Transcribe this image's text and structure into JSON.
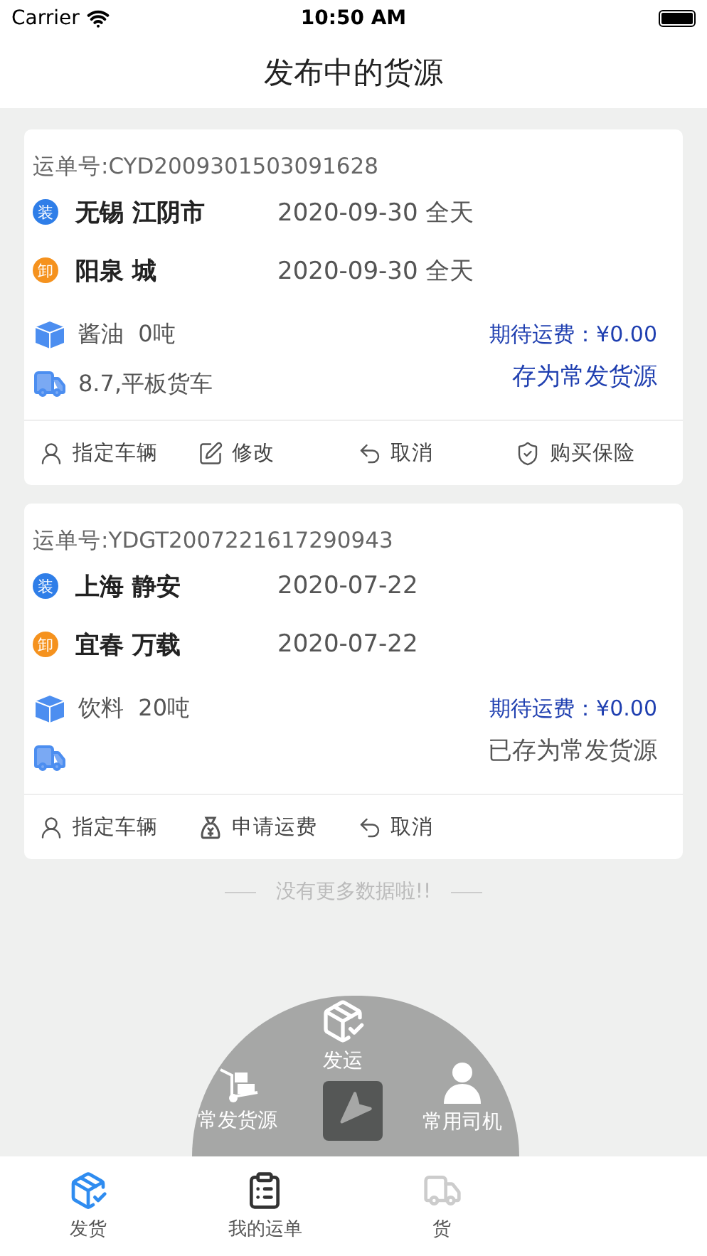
{
  "status_bar": {
    "carrier": "Carrier",
    "time": "10:50 AM"
  },
  "title": "发布中的货源",
  "orders": [
    {
      "number": "运单号:CYD2009301503091628",
      "load": {
        "badge": "装",
        "place": "无锡 江阴市",
        "date": "2020-09-30 全天"
      },
      "unload": {
        "badge": "卸",
        "place": "阳泉 城",
        "date": "2020-09-30 全天"
      },
      "cargo": "酱油  0吨",
      "vehicle": "8.7,平板货车",
      "freight": "期待运费：¥0.00",
      "save_label": "存为常发货源",
      "saved": false,
      "actions": [
        {
          "kind": "assign",
          "label": "指定车辆"
        },
        {
          "kind": "edit",
          "label": "修改"
        },
        {
          "kind": "cancel",
          "label": "取消"
        },
        {
          "kind": "insure",
          "label": "购买保险"
        }
      ]
    },
    {
      "number": "运单号:YDGT2007221617290943",
      "load": {
        "badge": "装",
        "place": "上海 静安",
        "date": "2020-07-22"
      },
      "unload": {
        "badge": "卸",
        "place": "宜春 万载",
        "date": "2020-07-22"
      },
      "cargo": "饮料  20吨",
      "freight": "期待运费：¥0.00",
      "save_label": "已存为常发货源",
      "saved": true,
      "actions": [
        {
          "kind": "assign",
          "label": "指定车辆"
        },
        {
          "kind": "fee",
          "label": "申请运费"
        },
        {
          "kind": "cancel",
          "label": "取消"
        }
      ]
    }
  ],
  "footer_note": "没有更多数据啦!!",
  "quick_menu": [
    {
      "kind": "ship",
      "label": "发运"
    },
    {
      "kind": "frequent",
      "label": "常发货源"
    },
    {
      "kind": "driver",
      "label": "常用司机"
    }
  ],
  "tab_bar": [
    {
      "kind": "ship",
      "label": "发货",
      "selected": true
    },
    {
      "kind": "orders",
      "label": "我的运单",
      "selected": false
    },
    {
      "kind": "transit",
      "label": "货",
      "selected": false
    }
  ]
}
